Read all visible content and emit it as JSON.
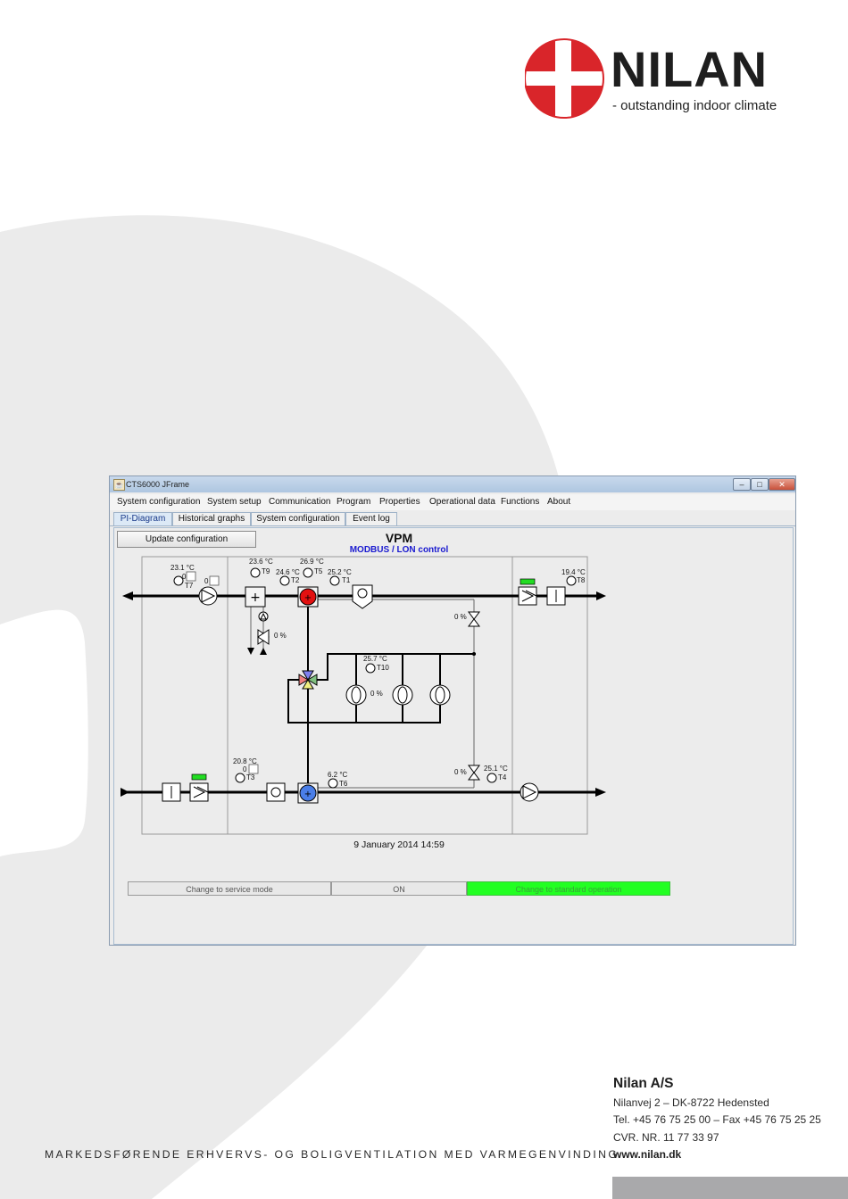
{
  "brand": {
    "name": "NILAN",
    "tagline": "- outstanding indoor climate",
    "colors": {
      "red": "#d9252a",
      "dark": "#1e1e1e",
      "swoosh": "#ebebeb"
    }
  },
  "window": {
    "title": "CTS6000 JFrame",
    "controls": [
      "minimize-icon",
      "maximize-icon",
      "close-icon"
    ],
    "menu": [
      "System configuration",
      "System setup",
      "Communication",
      "Program",
      "Properties",
      "Operational data",
      "Functions",
      "About"
    ],
    "tabs": [
      {
        "label": "PI-Diagram",
        "active": true
      },
      {
        "label": "Historical graphs",
        "active": false
      },
      {
        "label": "System configuration",
        "active": false
      },
      {
        "label": "Event log",
        "active": false
      }
    ],
    "update_button": "Update configuration",
    "diagram_title": "VPM",
    "diagram_subtitle": "MODBUS / LON control",
    "sensors": [
      {
        "id": "T7",
        "value": "23.1 °C"
      },
      {
        "id": "T9",
        "value": "23.6 °C"
      },
      {
        "id": "T2",
        "value": "24.6 °C"
      },
      {
        "id": "T5",
        "value": "26.9 °C"
      },
      {
        "id": "T1",
        "value": "25.2 °C"
      },
      {
        "id": "T8",
        "value": "19.4 °C"
      },
      {
        "id": "T10",
        "value": "25.7 °C"
      },
      {
        "id": "T3",
        "value": "20.8 °C"
      },
      {
        "id": "T6",
        "value": "6.2 °C"
      },
      {
        "id": "T4",
        "value": "25.1 °C"
      }
    ],
    "zero_labels": [
      "0",
      "0",
      "0"
    ],
    "percent_labels": [
      "0 %",
      "0 %",
      "0 %",
      "0 %"
    ],
    "timestamp": "9 January 2014 14:59",
    "status": {
      "service_mode": "Change to service mode",
      "state": "ON",
      "operation": "Change to standard operation",
      "operation_color": "#22ff22"
    }
  },
  "company": {
    "name": "Nilan A/S",
    "address": "Nilanvej 2 – DK-8722 Hedensted",
    "phone": "Tel. +45 76 75 25 00 – Fax +45 76 75 25 25",
    "cvr": "CVR. NR. 11 77 33 97",
    "web": "www.nilan.dk"
  },
  "slogan": "MARKEDSFØRENDE ERHVERVS- OG BOLIGVENTILATION MED VARMEGENVINDING"
}
